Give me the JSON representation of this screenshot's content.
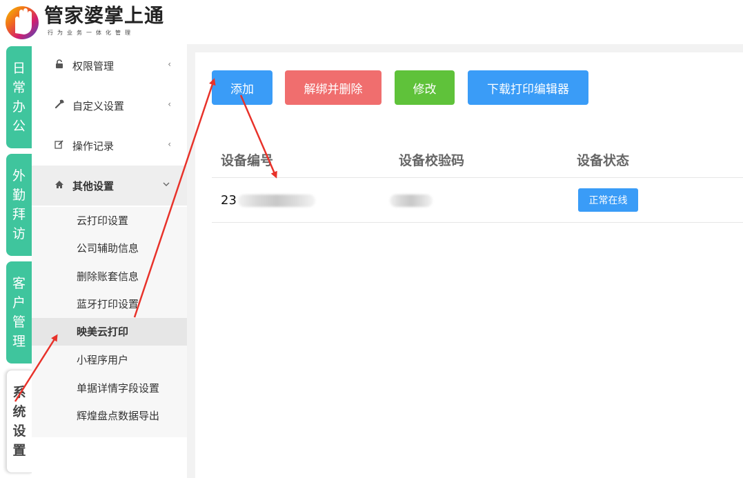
{
  "brand": {
    "title": "管家婆掌上通",
    "subtitle": "行为业务一体化管理"
  },
  "vertical_tabs": [
    {
      "label": "日常办公",
      "chars": [
        "日",
        "常",
        "办",
        "公"
      ]
    },
    {
      "label": "外勤拜访",
      "chars": [
        "外",
        "勤",
        "拜",
        "访"
      ]
    },
    {
      "label": "客户管理",
      "chars": [
        "客",
        "户",
        "管",
        "理"
      ]
    },
    {
      "label": "系统设置",
      "chars": [
        "系",
        "统",
        "设",
        "置"
      ],
      "active": true
    }
  ],
  "sidebar": {
    "items": [
      {
        "label": "权限管理",
        "icon": "lock-icon"
      },
      {
        "label": "自定义设置",
        "icon": "wrench-icon"
      },
      {
        "label": "操作记录",
        "icon": "edit-icon"
      },
      {
        "label": "其他设置",
        "icon": "home-icon",
        "expanded": true
      }
    ],
    "submenu": [
      "云打印设置",
      "公司辅助信息",
      "删除账套信息",
      "蓝牙打印设置",
      "映美云打印",
      "小程序用户",
      "单据详情字段设置",
      "辉煌盘点数据导出"
    ],
    "active_submenu": "映美云打印"
  },
  "toolbar": {
    "add": "添加",
    "unbind_delete": "解绑并删除",
    "edit": "修改",
    "download_editor": "下载打印编辑器"
  },
  "table": {
    "headers": [
      "设备编号",
      "设备校验码",
      "设备状态"
    ],
    "rows": [
      {
        "device_no_visible": "23",
        "status": "正常在线"
      }
    ]
  },
  "colors": {
    "accent_green": "#3fc59d",
    "btn_blue": "#3a9cf7",
    "btn_red": "#f06e6e",
    "btn_green": "#5fc23a",
    "arrow_red": "#e8322a"
  }
}
